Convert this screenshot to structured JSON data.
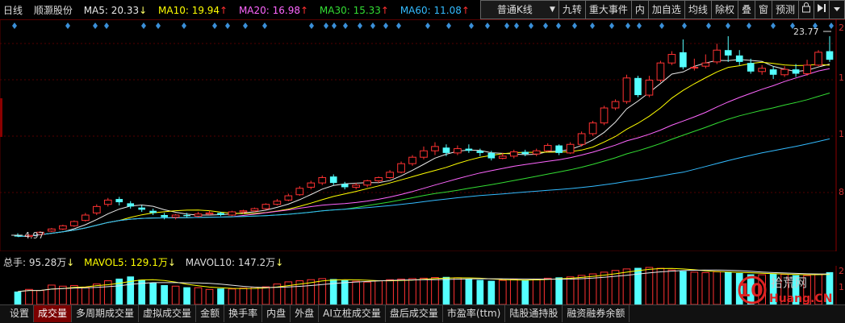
{
  "legend": {
    "period": "日线",
    "stock_name": "顺灏股份",
    "ma5": {
      "label": "MA5: 20.33",
      "arrow": "↓",
      "color": "#e8e8e8",
      "arrow_color": "#ffff66"
    },
    "ma10": {
      "label": "MA10: 19.94",
      "arrow": "↑",
      "color": "#ffff00",
      "arrow_color": "#ff3030"
    },
    "ma20": {
      "label": "MA20: 16.98",
      "arrow": "↑",
      "color": "#ff66ff",
      "arrow_color": "#ff3030"
    },
    "ma30": {
      "label": "MA30: 15.33",
      "arrow": "↑",
      "color": "#33dd33",
      "arrow_color": "#ff3030"
    },
    "ma60": {
      "label": "MA60: 11.08",
      "arrow": "↑",
      "color": "#33bbff",
      "arrow_color": "#ff3030"
    }
  },
  "toolbar": {
    "kline_type": "普通K线",
    "kline_arrow": "▼",
    "jiuzhuan": "九转",
    "major_events": "重大事件",
    "nei": "内",
    "add_watch": "加自选",
    "junxian": "均线",
    "chuquan": "除权",
    "die": "叠",
    "chuang": "窗",
    "yuce": "预测",
    "lock_icon": "lock-icon",
    "play_icon": "play-end-icon",
    "menu_icon": "dropdown-icon"
  },
  "chart": {
    "high_label": "23.77",
    "low_label": "4.97",
    "right_axis_top": "2",
    "right_axis_mid1": "1",
    "right_axis_mid2": "1",
    "right_axis_low": "8",
    "vol_axis_top": "2",
    "vol_axis_bot": "1",
    "up_color": "#ff3232",
    "down_color": "#54ffff",
    "chart_data": {
      "type": "candlestick",
      "candles": [
        [
          5.1,
          5.0,
          5.3,
          4.97
        ],
        [
          5.0,
          5.1,
          5.2,
          4.95
        ],
        [
          5.2,
          5.4,
          5.5,
          5.1
        ],
        [
          5.5,
          5.7,
          5.8,
          5.4
        ],
        [
          5.7,
          6.0,
          6.1,
          5.6
        ],
        [
          6.0,
          6.4,
          6.5,
          5.9
        ],
        [
          6.5,
          7.0,
          7.2,
          6.4
        ],
        [
          7.2,
          7.8,
          8.0,
          7.0
        ],
        [
          8.0,
          8.4,
          8.6,
          7.8
        ],
        [
          8.5,
          8.2,
          8.7,
          7.9
        ],
        [
          8.1,
          7.8,
          8.3,
          7.6
        ],
        [
          7.7,
          7.5,
          7.9,
          7.3
        ],
        [
          7.4,
          7.2,
          7.6,
          7.0
        ],
        [
          7.0,
          6.8,
          7.2,
          6.6
        ],
        [
          6.8,
          7.0,
          7.1,
          6.6
        ],
        [
          7.0,
          6.9,
          7.2,
          6.8
        ],
        [
          6.9,
          7.1,
          7.3,
          6.8
        ],
        [
          7.1,
          7.2,
          7.4,
          7.0
        ],
        [
          7.2,
          7.0,
          7.3,
          6.9
        ],
        [
          7.0,
          7.3,
          7.4,
          6.9
        ],
        [
          7.3,
          7.4,
          7.5,
          7.1
        ],
        [
          7.4,
          7.6,
          7.7,
          7.3
        ],
        [
          7.6,
          8.0,
          8.1,
          7.5
        ],
        [
          8.0,
          8.3,
          8.5,
          7.9
        ],
        [
          8.4,
          8.8,
          9.0,
          8.3
        ],
        [
          8.9,
          9.5,
          9.7,
          8.8
        ],
        [
          9.6,
          10.0,
          10.2,
          9.4
        ],
        [
          10.0,
          10.5,
          10.7,
          9.8
        ],
        [
          10.6,
          10.0,
          10.8,
          9.8
        ],
        [
          9.9,
          9.6,
          10.1,
          9.4
        ],
        [
          9.6,
          9.8,
          10.0,
          9.4
        ],
        [
          9.8,
          10.2,
          10.3,
          9.6
        ],
        [
          10.2,
          10.5,
          10.6,
          10.0
        ],
        [
          10.5,
          11.0,
          11.2,
          10.4
        ],
        [
          11.0,
          11.8,
          12.0,
          10.9
        ],
        [
          11.8,
          12.4,
          12.6,
          11.6
        ],
        [
          12.4,
          13.0,
          13.4,
          12.2
        ],
        [
          13.0,
          13.4,
          13.8,
          12.6
        ],
        [
          13.3,
          12.8,
          13.6,
          12.5
        ],
        [
          12.8,
          13.2,
          13.5,
          12.6
        ],
        [
          13.2,
          13.0,
          13.6,
          12.8
        ],
        [
          13.0,
          12.8,
          13.2,
          12.5
        ],
        [
          12.8,
          12.3,
          13.0,
          12.1
        ],
        [
          12.3,
          12.5,
          12.8,
          12.2
        ],
        [
          12.5,
          12.9,
          13.1,
          12.3
        ],
        [
          12.9,
          12.7,
          13.1,
          12.5
        ],
        [
          12.7,
          13.0,
          13.2,
          12.5
        ],
        [
          13.0,
          13.5,
          13.7,
          12.9
        ],
        [
          13.5,
          12.8,
          13.6,
          12.6
        ],
        [
          12.8,
          13.6,
          13.8,
          12.7
        ],
        [
          13.6,
          14.6,
          14.8,
          13.4
        ],
        [
          14.6,
          15.6,
          15.8,
          14.4
        ],
        [
          15.6,
          17.0,
          17.2,
          15.4
        ],
        [
          17.0,
          17.6,
          17.8,
          16.8
        ],
        [
          17.6,
          19.8,
          20.1,
          17.4
        ],
        [
          19.8,
          18.2,
          20.0,
          18.0
        ],
        [
          18.2,
          19.6,
          20.0,
          18.0
        ],
        [
          19.6,
          21.2,
          21.4,
          19.4
        ],
        [
          21.2,
          22.0,
          22.3,
          21.0
        ],
        [
          22.2,
          20.8,
          23.4,
          20.6
        ],
        [
          20.8,
          20.8,
          21.6,
          20.5
        ],
        [
          20.9,
          21.2,
          22.0,
          20.7
        ],
        [
          21.3,
          22.4,
          23.0,
          21.1
        ],
        [
          22.4,
          21.9,
          23.7,
          21.3
        ],
        [
          21.9,
          21.3,
          22.4,
          21.0
        ],
        [
          21.2,
          20.4,
          21.6,
          20.2
        ],
        [
          20.4,
          20.7,
          21.0,
          20.1
        ],
        [
          20.6,
          20.1,
          20.9,
          19.7
        ],
        [
          20.1,
          20.6,
          20.9,
          19.9
        ],
        [
          20.6,
          20.2,
          21.1,
          19.9
        ],
        [
          20.2,
          21.0,
          21.5,
          20.0
        ],
        [
          21.0,
          22.2,
          22.4,
          20.9
        ],
        [
          22.3,
          21.5,
          23.7,
          21.3
        ]
      ],
      "volumes": [
        60,
        70,
        65,
        90,
        85,
        88,
        80,
        95,
        110,
        120,
        130,
        115,
        100,
        90,
        85,
        80,
        78,
        70,
        74,
        72,
        76,
        80,
        82,
        95,
        105,
        110,
        115,
        120,
        118,
        112,
        108,
        104,
        110,
        115,
        118,
        120,
        122,
        125,
        128,
        124,
        118,
        114,
        110,
        112,
        116,
        114,
        118,
        122,
        126,
        128,
        135,
        142,
        150,
        158,
        165,
        170,
        172,
        168,
        160,
        155,
        150,
        148,
        152,
        150,
        146,
        140,
        138,
        142,
        140,
        136,
        134,
        140,
        150
      ],
      "ylim": [
        4.97,
        23.77
      ]
    }
  },
  "volume": {
    "label_total": "总手: 95.28万",
    "label_total_arrow": "↓",
    "label_mavol5": "MAVOL5: 129.1万",
    "label_mavol5_arrow": "↓",
    "label_mavol10": "MAVOL10: 147.2万",
    "label_mavol10_arrow": "↓"
  },
  "tabs": [
    {
      "label": "设置",
      "marker": "▼"
    },
    {
      "label": "成交量"
    },
    {
      "label": "多周期成交量"
    },
    {
      "label": "虚拟成交量"
    },
    {
      "label": "金额"
    },
    {
      "label": "换手率"
    },
    {
      "label": "内盘"
    },
    {
      "label": "外盘"
    },
    {
      "label": "AI立桩成交量"
    },
    {
      "label": "盘后成交量"
    },
    {
      "label": "市盈率(ttm)"
    },
    {
      "label": "陆股通持股"
    },
    {
      "label": "融资融券余额"
    }
  ],
  "watermark": {
    "digits": "10",
    "cn_text": "拾荒网",
    "url_text": "Huang.CN"
  }
}
